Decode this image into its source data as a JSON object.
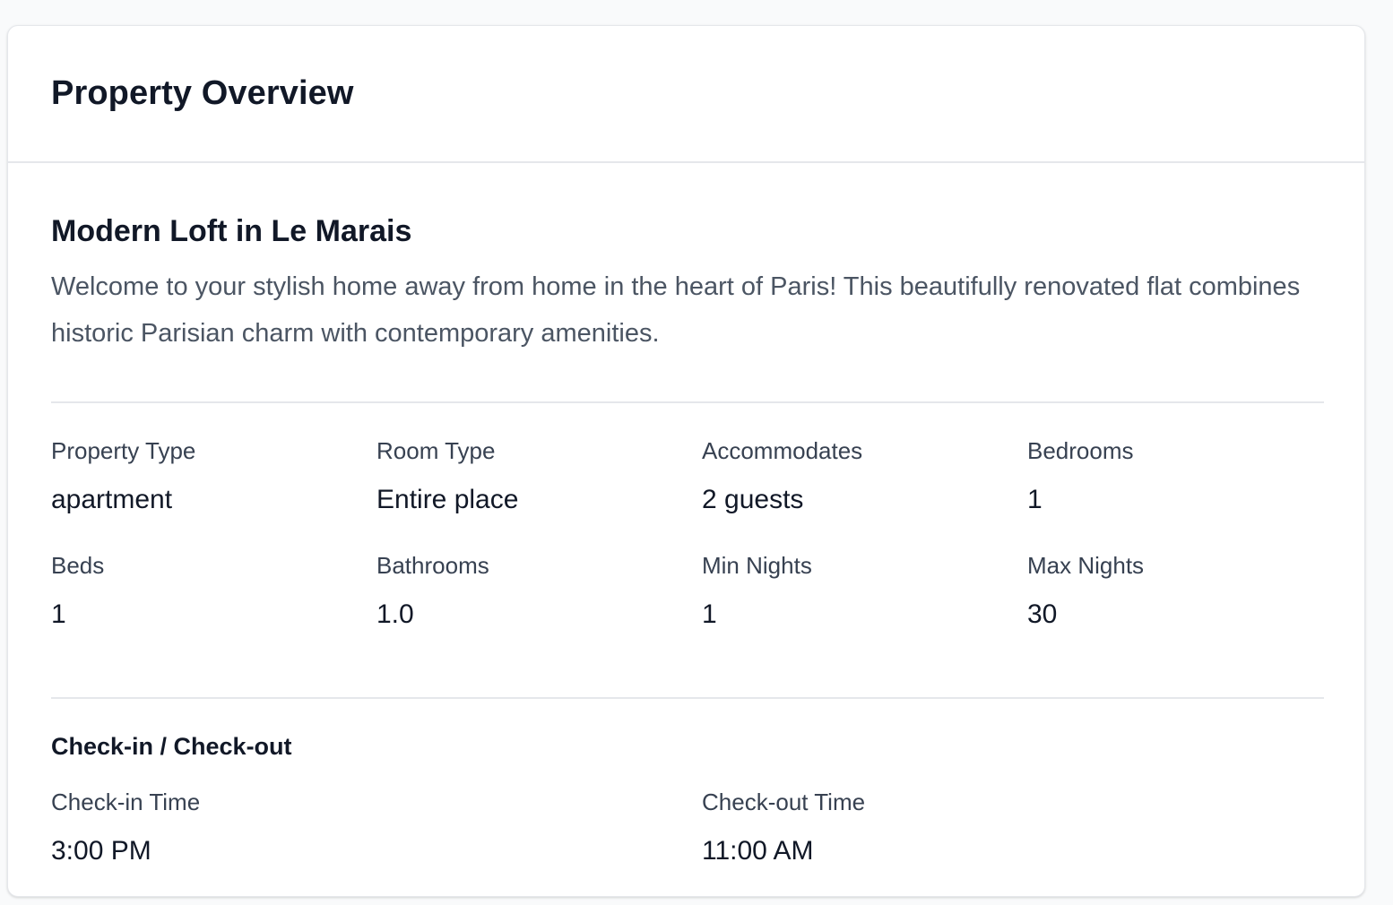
{
  "card": {
    "title": "Property Overview"
  },
  "listing": {
    "title": "Modern Loft in Le Marais",
    "description": "Welcome to your stylish home away from home in the heart of Paris! This beautifully renovated flat combines historic Parisian charm with contemporary amenities."
  },
  "stats": [
    {
      "label": "Property Type",
      "value": "apartment"
    },
    {
      "label": "Room Type",
      "value": "Entire place"
    },
    {
      "label": "Accommodates",
      "value": "2 guests"
    },
    {
      "label": "Bedrooms",
      "value": "1"
    },
    {
      "label": "Beds",
      "value": "1"
    },
    {
      "label": "Bathrooms",
      "value": "1.0"
    },
    {
      "label": "Min Nights",
      "value": "1"
    },
    {
      "label": "Max Nights",
      "value": "30"
    }
  ],
  "checkin": {
    "heading": "Check-in / Check-out",
    "checkin_label": "Check-in Time",
    "checkin_value": "3:00 PM",
    "checkout_label": "Check-out Time",
    "checkout_value": "11:00 AM"
  },
  "colors": {
    "heading_text": "#111827",
    "body_text": "#4b5563",
    "label_text": "#374151",
    "divider": "#e5e7eb",
    "page_background": "#f9fafb",
    "card_background": "#ffffff"
  }
}
